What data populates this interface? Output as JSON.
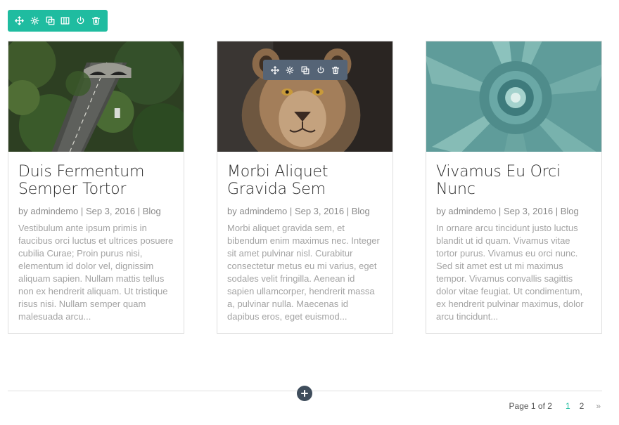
{
  "section_toolbar": {
    "color": "#1fbca0",
    "icons": [
      "move-icon",
      "settings-icon",
      "duplicate-icon",
      "columns-icon",
      "power-icon",
      "trash-icon"
    ]
  },
  "module_toolbar": {
    "color": "#556476",
    "icons": [
      "move-icon",
      "settings-icon",
      "duplicate-icon",
      "power-icon",
      "trash-icon"
    ]
  },
  "posts": [
    {
      "title": "Duis Fermentum Semper Tortor",
      "author": "admindemo",
      "date": "Sep 3, 2016",
      "category": "Blog",
      "excerpt": "Vestibulum ante ipsum primis in faucibus orci luctus et ultrices posuere cubilia Curae; Proin purus nisi, elementum id dolor vel, dignissim aliquam sapien. Nullam mattis tellus non ex hendrerit aliquam. Ut tristique risus nisi. Nullam semper quam malesuada arcu...",
      "image": "aerial-forest-highway"
    },
    {
      "title": "Morbi Aliquet Gravida Sem",
      "author": "admindemo",
      "date": "Sep 3, 2016",
      "category": "Blog",
      "excerpt": "Morbi aliquet gravida sem, et bibendum enim maximus nec. Integer sit amet pulvinar nisl. Curabitur consectetur metus eu mi varius, eget sodales velit fringilla. Aenean id sapien ullamcorper, hendrerit massa a, pulvinar nulla. Maecenas id dapibus eros, eget euismod...",
      "image": "lioness-portrait"
    },
    {
      "title": "Vivamus Eu Orci Nunc",
      "author": "admindemo",
      "date": "Sep 3, 2016",
      "category": "Blog",
      "excerpt": "In ornare arcu tincidunt justo luctus blandit ut id quam. Vivamus vitae tortor purus. Vivamus eu orci nunc. Sed sit amet est ut mi maximus tempor. Vivamus convallis sagittis dolor vitae feugiat. Ut condimentum, ex hendrerit pulvinar maximus, dolor arcu tincidunt...",
      "image": "succulent-plant"
    }
  ],
  "meta": {
    "by": "by",
    "sep": "|"
  },
  "pagination": {
    "label": "Page 1 of 2",
    "pages": [
      "1",
      "2"
    ],
    "current": "1",
    "next": "»"
  },
  "add_row_icon": "plus-icon"
}
